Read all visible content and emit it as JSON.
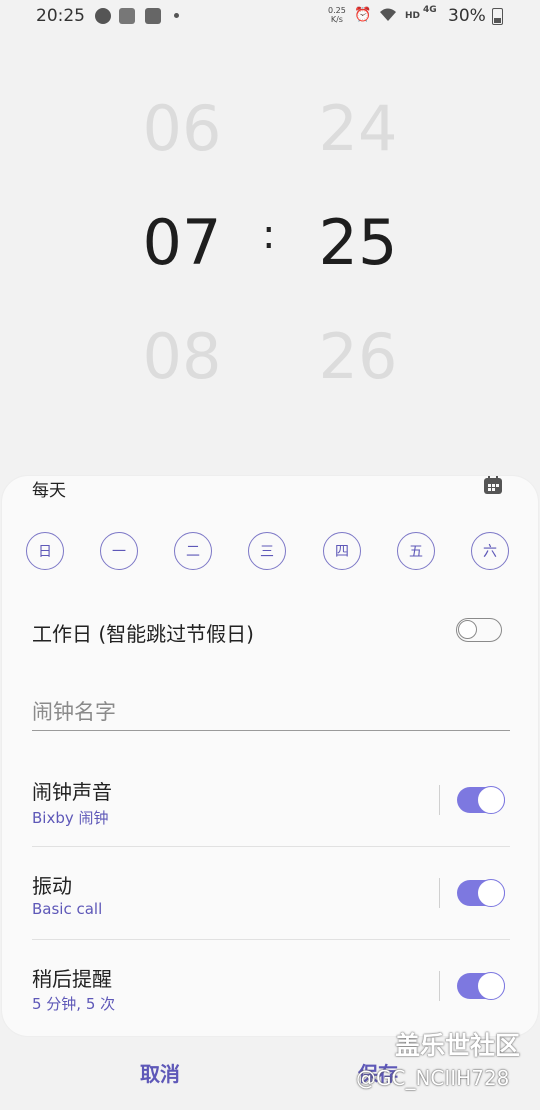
{
  "status_bar": {
    "time": "20:25",
    "net_speed": "0.25",
    "net_unit": "K/s",
    "hd": "HD",
    "signal": "4G",
    "battery": "30%"
  },
  "picker": {
    "hour_prev": "06",
    "hour": "07",
    "hour_next": "08",
    "minute_prev": "24",
    "minute": "25",
    "minute_next": "26",
    "separator": ":"
  },
  "repeat": {
    "label": "每天",
    "days": [
      "日",
      "一",
      "二",
      "三",
      "四",
      "五",
      "六"
    ]
  },
  "workday": {
    "label": "工作日 (智能跳过节假日)",
    "enabled": false
  },
  "alarm_name": {
    "placeholder": "闹钟名字",
    "value": ""
  },
  "settings": [
    {
      "title": "闹钟声音",
      "subtitle": "Bixby 闹钟",
      "enabled": true
    },
    {
      "title": "振动",
      "subtitle": "Basic call",
      "enabled": true
    },
    {
      "title": "稍后提醒",
      "subtitle": "5 分钟, 5 次",
      "enabled": true
    }
  ],
  "buttons": {
    "cancel": "取消",
    "save": "保存"
  },
  "watermark": {
    "line1": "盖乐世社区",
    "line2": "@GC_NCIIH728"
  },
  "colors": {
    "accent": "#5e58b8",
    "toggle_on": "#7d78e0",
    "background": "#f2f2f2"
  }
}
